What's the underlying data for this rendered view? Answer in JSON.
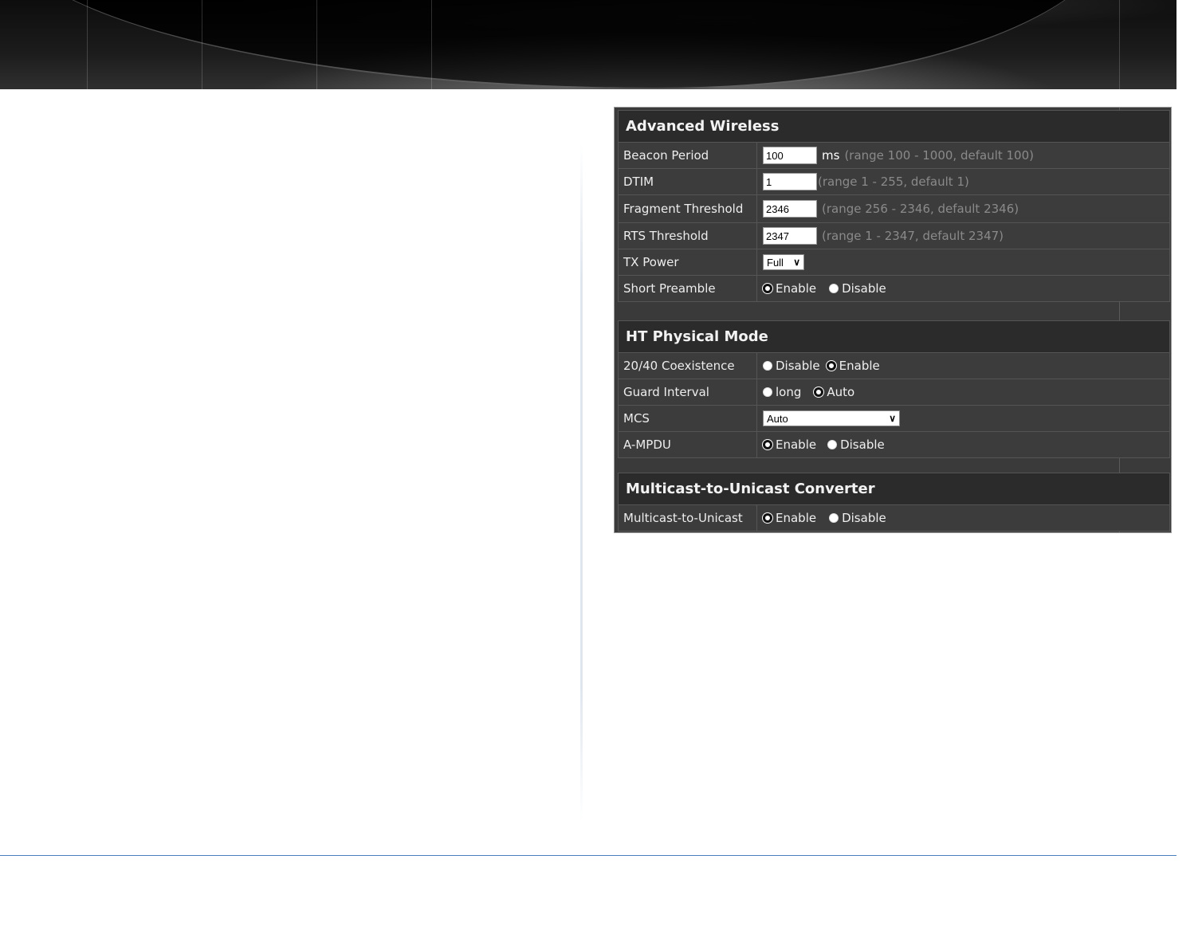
{
  "advanced_wireless": {
    "title": "Advanced Wireless",
    "beacon_period": {
      "label": "Beacon Period",
      "value": "100",
      "unit": "ms",
      "hint": "(range 100 - 1000, default 100)"
    },
    "dtim": {
      "label": "DTIM",
      "value": "1",
      "hint": "(range 1 - 255, default 1)"
    },
    "fragment_threshold": {
      "label": "Fragment Threshold",
      "value": "2346",
      "hint": "(range 256 - 2346, default 2346)"
    },
    "rts_threshold": {
      "label": "RTS Threshold",
      "value": "2347",
      "hint": "(range 1 - 2347, default 2347)"
    },
    "tx_power": {
      "label": "TX Power",
      "selected": "Full"
    },
    "short_preamble": {
      "label": "Short Preamble",
      "options": [
        "Enable",
        "Disable"
      ],
      "selected": "Enable"
    }
  },
  "ht_physical_mode": {
    "title": "HT Physical Mode",
    "coexistence": {
      "label": "20/40 Coexistence",
      "options": [
        "Disable",
        "Enable"
      ],
      "selected": "Enable"
    },
    "guard_interval": {
      "label": "Guard Interval",
      "options": [
        "long",
        "Auto"
      ],
      "selected": "Auto"
    },
    "mcs": {
      "label": "MCS",
      "selected": "Auto"
    },
    "ampdu": {
      "label": "A-MPDU",
      "options": [
        "Enable",
        "Disable"
      ],
      "selected": "Enable"
    }
  },
  "multicast": {
    "title": "Multicast-to-Unicast Converter",
    "converter": {
      "label": "Multicast-to-Unicast",
      "options": [
        "Enable",
        "Disable"
      ],
      "selected": "Enable"
    }
  }
}
